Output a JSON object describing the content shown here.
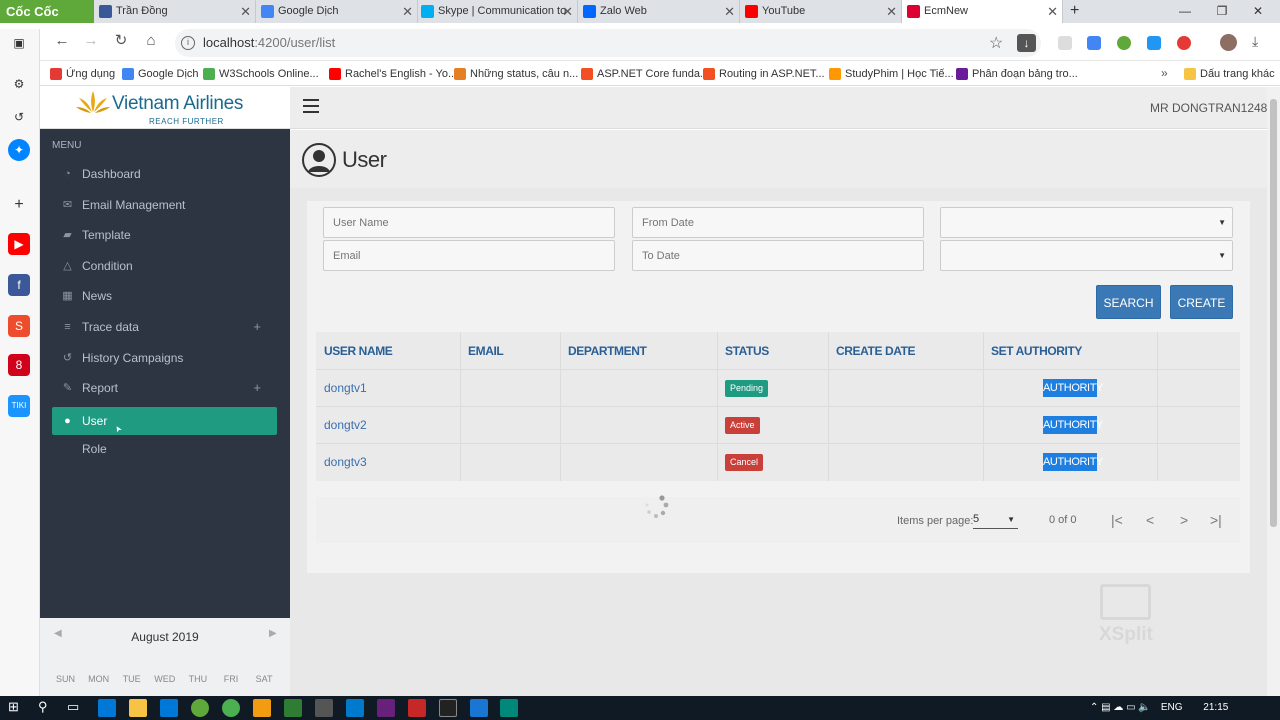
{
  "browser": {
    "brand": "Cốc Cốc",
    "tabs": [
      {
        "title": "Trần Đồng",
        "icon": "facebook-icon",
        "color": "#3b5998"
      },
      {
        "title": "Google Dịch",
        "icon": "google-translate-icon",
        "color": "#4285f4"
      },
      {
        "title": "Skype | Communication to",
        "icon": "skype-icon",
        "color": "#00aff0"
      },
      {
        "title": "Zalo Web",
        "icon": "zalo-icon",
        "color": "#0068ff"
      },
      {
        "title": "YouTube",
        "icon": "youtube-icon",
        "color": "#ff0000"
      },
      {
        "title": "EcmNew",
        "icon": "angular-icon",
        "color": "#dd0031"
      }
    ],
    "url_host": "localhost",
    "url_path": ":4200/user/list",
    "bookmarks": [
      {
        "label": "Ứng dụng",
        "color": "#e53935"
      },
      {
        "label": "Google Dịch",
        "color": "#4285f4"
      },
      {
        "label": "W3Schools Online...",
        "color": "#4caf50"
      },
      {
        "label": "Rachel's English - Yo...",
        "color": "#ff0000"
      },
      {
        "label": "Những status, câu n...",
        "color": "#e67e22"
      },
      {
        "label": "ASP.NET Core funda...",
        "color": "#f25022"
      },
      {
        "label": "Routing in ASP.NET...",
        "color": "#f25022"
      },
      {
        "label": "StudyPhim | Học Tiế...",
        "color": "#ff9800"
      },
      {
        "label": "Phân đoạn bảng tro...",
        "color": "#6a1b9a"
      }
    ],
    "bookmarks_more": "»",
    "bookmarks_folder": "Dấu trang khác"
  },
  "app": {
    "logo_text": "Vietnam Airlines",
    "logo_tagline": "REACH FURTHER",
    "menu_header": "MENU",
    "menu": [
      {
        "label": "Dashboard",
        "icon": "dashboard-icon",
        "glyph": "◔",
        "expandable": false
      },
      {
        "label": "Email Management",
        "icon": "envelope-icon",
        "glyph": "✉",
        "expandable": false
      },
      {
        "label": "Template",
        "icon": "folder-icon",
        "glyph": "▰",
        "expandable": false
      },
      {
        "label": "Condition",
        "icon": "warning-icon",
        "glyph": "△",
        "expandable": false
      },
      {
        "label": "News",
        "icon": "gift-icon",
        "glyph": "▦",
        "expandable": false
      },
      {
        "label": "Trace data",
        "icon": "database-icon",
        "glyph": "≡",
        "expandable": true
      },
      {
        "label": "History Campaigns",
        "icon": "history-icon",
        "glyph": "↺",
        "expandable": false
      },
      {
        "label": "Report",
        "icon": "edit-icon",
        "glyph": "✎",
        "expandable": true
      },
      {
        "label": "User",
        "icon": "user-icon",
        "glyph": "●",
        "expandable": false,
        "active": true
      },
      {
        "label": "Role",
        "icon": "",
        "glyph": "",
        "expandable": false
      }
    ],
    "expand_glyph": "+",
    "calendar": {
      "month": "August 2019",
      "days": [
        "SUN",
        "MON",
        "TUE",
        "WED",
        "THU",
        "FRI",
        "SAT"
      ]
    },
    "header_user": "MR DONGTRAN1248",
    "page_title": "User",
    "filters": {
      "username_placeholder": "User Name",
      "email_placeholder": "Email",
      "from_date_placeholder": "From Date",
      "to_date_placeholder": "To Date"
    },
    "buttons": {
      "search": "SEARCH",
      "create": "CREATE"
    },
    "table": {
      "columns": [
        "USER NAME",
        "EMAIL",
        "DEPARTMENT",
        "STATUS",
        "CREATE DATE",
        "SET AUTHORITY"
      ],
      "rows": [
        {
          "username": "dongtv1",
          "email": "",
          "department": "",
          "status": "Pending",
          "status_color": "#1f9b82",
          "create_date": "",
          "action": "AUTHORITY"
        },
        {
          "username": "dongtv2",
          "email": "",
          "department": "",
          "status": "Active",
          "status_color": "#c9403a",
          "create_date": "",
          "action": "AUTHORITY"
        },
        {
          "username": "dongtv3",
          "email": "",
          "department": "",
          "status": "Cancel",
          "status_color": "#c9403a",
          "create_date": "",
          "action": "AUTHORITY"
        }
      ]
    },
    "paginator": {
      "items_per_page_label": "Items per page:",
      "items_per_page": "5",
      "range": "0 of 0"
    },
    "watermark": "XSplit"
  },
  "taskbar": {
    "lang": "ENG",
    "time": "21:15"
  }
}
